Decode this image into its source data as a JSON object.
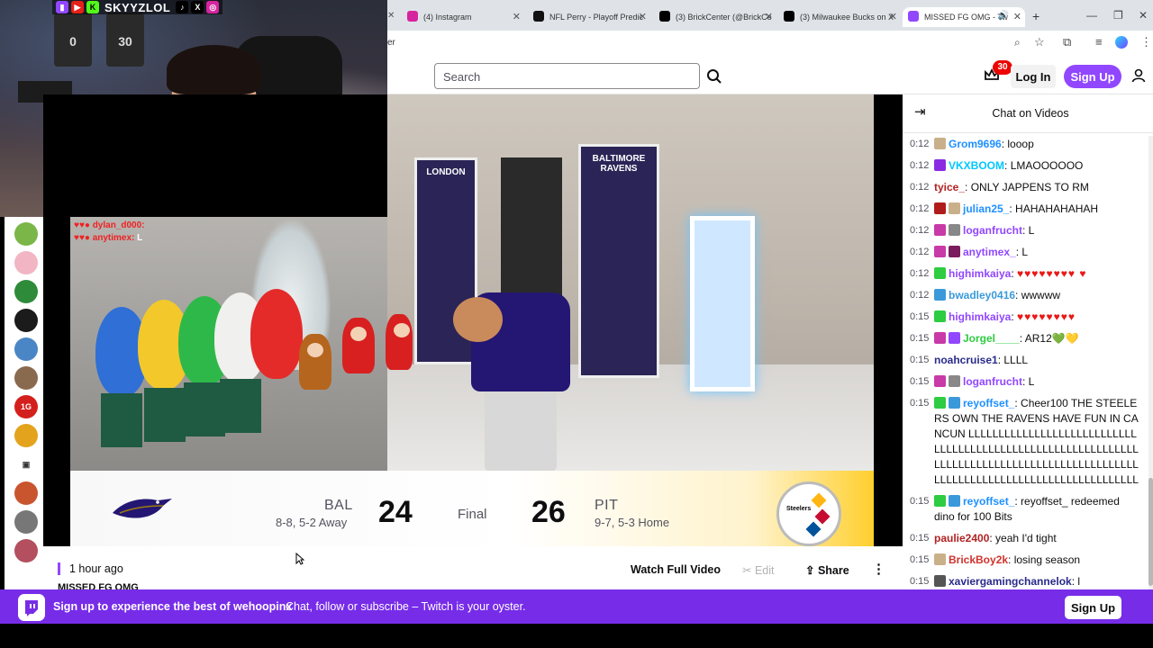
{
  "webcam": {
    "handle": "SKYYZLOL",
    "socials": [
      "twitch-icon",
      "youtube-icon",
      "kick-icon",
      "tiktok-icon",
      "x-icon",
      "instagram-icon"
    ],
    "jerseys": [
      "0",
      "30"
    ]
  },
  "browser": {
    "tabs": [
      {
        "label": "(4) Instagram",
        "color": "#d6249f"
      },
      {
        "label": "NFL Perry - Playoff Predic",
        "color": "#111111"
      },
      {
        "label": "(3) BrickCenter (@BrickCe",
        "color": "#000000"
      },
      {
        "label": "(3) Milwaukee Bucks on X",
        "color": "#000000"
      },
      {
        "label": "MISSED FG OMG - Tw",
        "color": "#9147ff",
        "active": true
      }
    ],
    "address_peek": "er"
  },
  "header": {
    "search_placeholder": "Search",
    "notification_count": "30",
    "login_label": "Log In",
    "signup_label": "Sign Up"
  },
  "rail": {
    "avatars": [
      {
        "color": "#7ab648"
      },
      {
        "color": "#f2b5c4"
      },
      {
        "color": "#2e8b3a"
      },
      {
        "color": "#1b1b1b"
      },
      {
        "color": "#4a86c5"
      },
      {
        "color": "#8a6a4f"
      },
      {
        "color": "#d4201c",
        "text": "1G"
      },
      {
        "color": "#e3a31c"
      },
      {
        "color": "#444444",
        "camera": true
      },
      {
        "color": "#c9552f"
      },
      {
        "color": "#777777"
      },
      {
        "color": "#b34f5e"
      }
    ]
  },
  "video": {
    "mini_chat": [
      {
        "user": "dylan_d000",
        "text": ""
      },
      {
        "user": "anytimex",
        "text": "L"
      }
    ],
    "banners": [
      "LONDON",
      "BALTIMORE RAVENS"
    ],
    "scoreboard": {
      "away_abbr": "BAL",
      "away_record": "8-8, 5-2 Away",
      "away_score": "24",
      "status": "Final",
      "home_score": "26",
      "home_abbr": "PIT",
      "home_record": "9-7, 5-3 Home",
      "home_logo_text": "Steelers"
    }
  },
  "info_bar": {
    "time_ago": "1 hour ago",
    "title_peek": "MISSED FG OMG",
    "watch_full": "Watch Full Video",
    "edit": "Edit",
    "share": "Share",
    "more": "⋮"
  },
  "chat": {
    "title": "Chat on Videos",
    "messages": [
      {
        "ts": "0:12",
        "user": "Grom9696",
        "color": "#1e90ff",
        "badges": [
          "#c9b08a"
        ],
        "text": "looop"
      },
      {
        "ts": "0:12",
        "user": "VKXBOOM",
        "color": "#00c8ff",
        "badges": [
          "#8a2be2"
        ],
        "text": "LMAOOOOOO"
      },
      {
        "ts": "0:12",
        "user": "tyice_",
        "color": "#b22222",
        "badges": [],
        "text": "ONLY JAPPENS TO RM"
      },
      {
        "ts": "0:12",
        "user": "julian25_",
        "color": "#1e90ff",
        "badges": [
          "#b01c1c",
          "#c9b08a"
        ],
        "text": "HAHAHAHAHAH"
      },
      {
        "ts": "0:12",
        "user": "loganfrucht",
        "color": "#9147ff",
        "badges": [
          "#c83aa8",
          "#888888"
        ],
        "text": "L"
      },
      {
        "ts": "0:12",
        "user": "anytimex_",
        "color": "#9147ff",
        "badges": [
          "#c83aa8",
          "#7a1c5e"
        ],
        "text": "L"
      },
      {
        "ts": "0:12",
        "user": "highimkaiya",
        "color": "#9147ff",
        "badges": [
          "#2ecc40"
        ],
        "text": "♥♥♥♥♥♥♥♥ ♥",
        "hearts": true
      },
      {
        "ts": "0:12",
        "user": "bwadley0416",
        "color": "#3a9ad9",
        "badges": [
          "#3a9ad9"
        ],
        "text": "wwwww"
      },
      {
        "ts": "0:15",
        "user": "highimkaiya",
        "color": "#9147ff",
        "badges": [
          "#2ecc40"
        ],
        "text": "♥♥♥♥♥♥♥♥",
        "hearts": true
      },
      {
        "ts": "0:15",
        "user": "Jorgel____",
        "color": "#2ecc40",
        "badges": [
          "#c83aa8",
          "#9147ff"
        ],
        "text": "AR12💚💛"
      },
      {
        "ts": "0:15",
        "user": "noahcruise1",
        "color": "#2a2a8a",
        "badges": [],
        "text": "LLLL"
      },
      {
        "ts": "0:15",
        "user": "loganfrucht",
        "color": "#9147ff",
        "badges": [
          "#c83aa8",
          "#888888"
        ],
        "text": "L"
      },
      {
        "ts": "0:15",
        "user": "reyoffset_",
        "color": "#1e90ff",
        "badges": [
          "#2ecc40",
          "#3a9ad9"
        ],
        "text": "Cheer100 THE STEELERS OWN THE RAVENS HAVE FUN IN CANCUN LLLLLLLLLLLLLLLLLLLLLLLLLLLLLLLLLLLLLLLLLLLLLLLLLLLLLLLLLLLLLLLLLLLLLLLLLLLLLLLLLLLLLLLLLLLLLLLLLLLLLLLLLLLLLLLLLLLLLLLLLLLLLLLLLL"
      },
      {
        "ts": "0:15",
        "user": "reyoffset_",
        "color": "#1e90ff",
        "badges": [
          "#2ecc40",
          "#3a9ad9"
        ],
        "text": "reyoffset_ redeemed dino for 100 Bits"
      },
      {
        "ts": "0:15",
        "user": "paulie2400",
        "color": "#b22222",
        "badges": [],
        "text": "yeah I'd tight"
      },
      {
        "ts": "0:15",
        "user": "BrickBoy2k",
        "color": "#d2322d",
        "badges": [
          "#c9b08a"
        ],
        "text": "losing season"
      },
      {
        "ts": "0:15",
        "user": "xaviergamingchannelok",
        "color": "#2a2a8a",
        "badges": [
          "#555555"
        ],
        "text": "l"
      }
    ]
  },
  "promo": {
    "headline": "Sign up to experience the best of wehoopinx",
    "sub": "Chat, follow or subscribe – Twitch is your oyster.",
    "button": "Sign Up"
  }
}
